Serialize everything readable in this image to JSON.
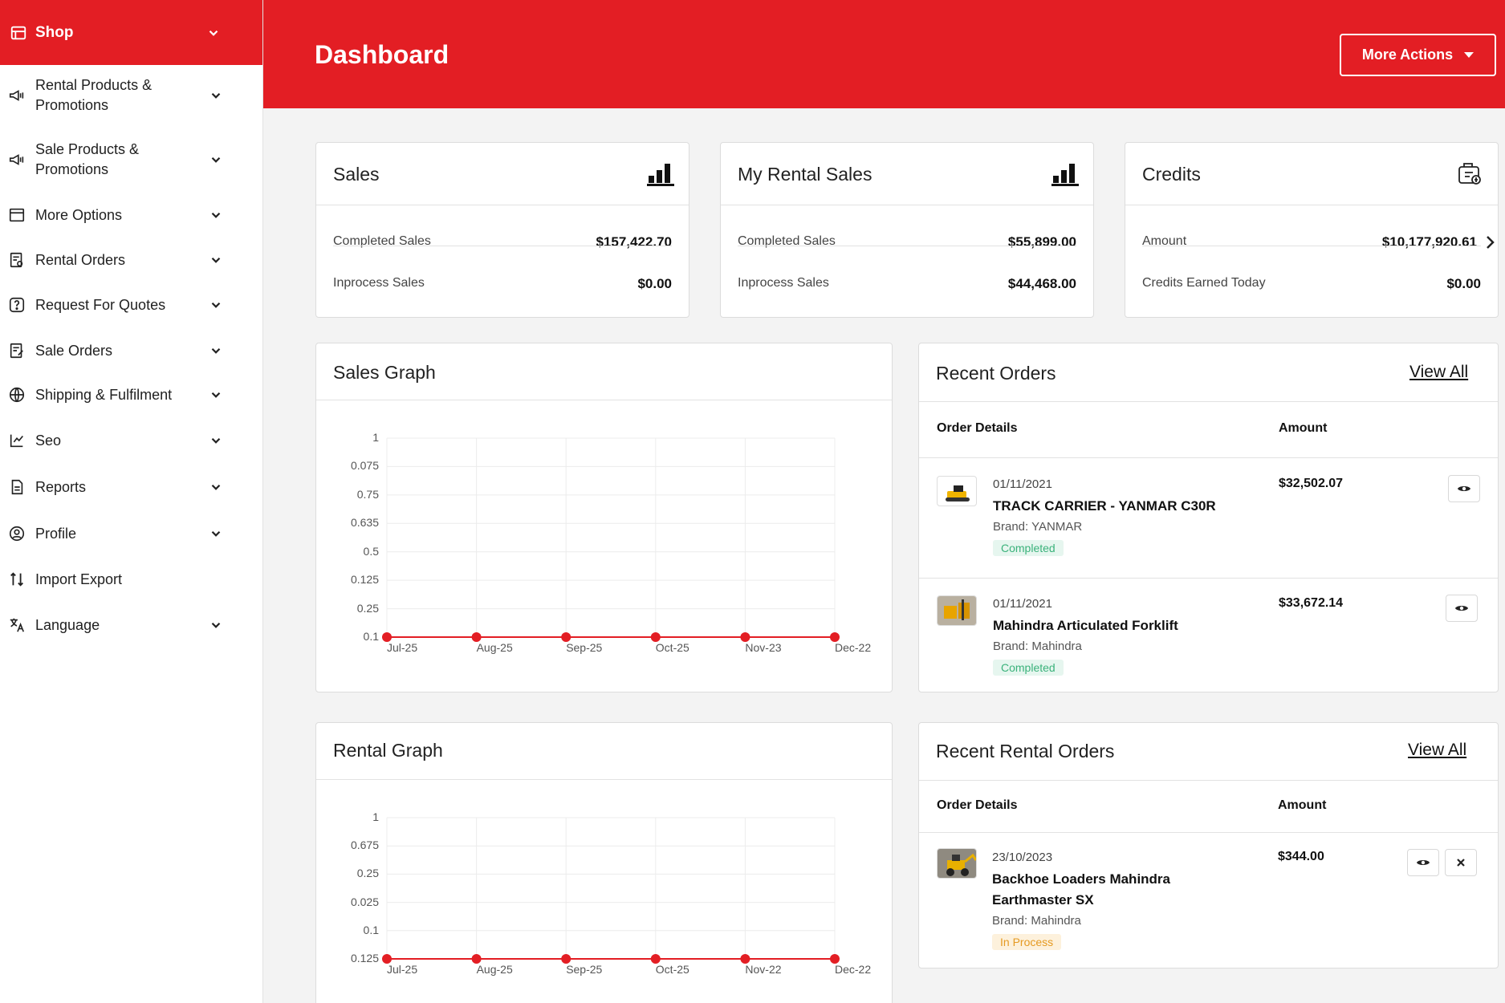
{
  "sidebar": {
    "header": {
      "label": "Shop",
      "icon": "shop-icon"
    },
    "items": [
      {
        "label": "Rental Products &\nPromotions",
        "icon": "megaphone-icon"
      },
      {
        "label": "Sale Products &\nPromotions",
        "icon": "megaphone-icon"
      },
      {
        "label": "More Options",
        "icon": "window-icon"
      },
      {
        "label": "Rental Orders",
        "icon": "order-icon"
      },
      {
        "label": "Request For Quotes",
        "icon": "question-icon"
      },
      {
        "label": "Sale Orders",
        "icon": "order-icon"
      },
      {
        "label": "Shipping & Fulfilment",
        "icon": "globe-icon"
      },
      {
        "label": "Seo",
        "icon": "seo-icon"
      },
      {
        "label": "Reports",
        "icon": "report-icon"
      },
      {
        "label": "Profile",
        "icon": "profile-icon"
      },
      {
        "label": "Import Export",
        "icon": "import-export-icon"
      },
      {
        "label": "Language",
        "icon": "language-icon"
      }
    ]
  },
  "header": {
    "title": "Dashboard",
    "more_actions": "More Actions"
  },
  "colors": {
    "brand_red": "#e31e24",
    "completed_green": "#3bb27b",
    "in_process_orange": "#e59a22"
  },
  "cards": {
    "sales": {
      "title": "Sales",
      "icon": "bar-chart-icon",
      "row1_label": "Completed Sales",
      "row1_value": "$157,422.70",
      "row2_label": "Inprocess Sales",
      "row2_value": "$0.00"
    },
    "rental_sales": {
      "title": "My Rental Sales",
      "icon": "bar-chart-icon",
      "row1_label": "Completed Sales",
      "row1_value": "$55,899.00",
      "row2_label": "Inprocess Sales",
      "row2_value": "$44,468.00"
    },
    "credits": {
      "title": "Credits",
      "icon": "credits-icon",
      "row1_label": "Amount",
      "row1_value": "$10,177,920.61",
      "row2_label": "Credits Earned Today",
      "row2_value": "$0.00"
    }
  },
  "sales_graph": {
    "title": "Sales Graph"
  },
  "rental_graph": {
    "title": "Rental Graph"
  },
  "chart_data": [
    {
      "type": "line",
      "title": "Sales Graph",
      "categories": [
        "Jul-25",
        "Aug-25",
        "Sep-25",
        "Oct-25",
        "Nov-23",
        "Dec-22"
      ],
      "y_tick_labels": [
        "1",
        "0.075",
        "0.75",
        "0.635",
        "0.5",
        "0.125",
        "0.25",
        "0.1"
      ],
      "series": [
        {
          "values": [
            0,
            0,
            0,
            0,
            0,
            0
          ],
          "color": "#e31e24"
        }
      ]
    },
    {
      "type": "line",
      "title": "Rental Graph",
      "categories": [
        "Jul-25",
        "Aug-25",
        "Sep-25",
        "Oct-25",
        "Nov-22",
        "Dec-22"
      ],
      "y_tick_labels": [
        "1",
        "0.675",
        "0.25",
        "0.025",
        "0.1",
        "0.125"
      ],
      "series": [
        {
          "values": [
            0,
            0,
            0,
            0,
            0,
            0
          ],
          "color": "#e31e24"
        }
      ]
    }
  ],
  "recent_orders": {
    "title": "Recent Orders",
    "view_all": "View All",
    "col_details": "Order Details",
    "col_amount": "Amount",
    "items": [
      {
        "date": "01/11/2021",
        "name": "TRACK CARRIER - YANMAR C30R",
        "brand": "Brand: YANMAR",
        "status": "Completed",
        "amount": "$32,502.07"
      },
      {
        "date": "01/11/2021",
        "name": "Mahindra Articulated Forklift",
        "brand": "Brand: Mahindra",
        "status": "Completed",
        "amount": "$33,672.14"
      }
    ]
  },
  "recent_rental_orders": {
    "title": "Recent Rental Orders",
    "view_all": "View All",
    "col_details": "Order Details",
    "col_amount": "Amount",
    "items": [
      {
        "date": "23/10/2023",
        "name_line1": "Backhoe Loaders Mahindra",
        "name_line2": "Earthmaster SX",
        "brand": "Brand: Mahindra",
        "status": "In Process",
        "amount": "$344.00"
      }
    ]
  }
}
